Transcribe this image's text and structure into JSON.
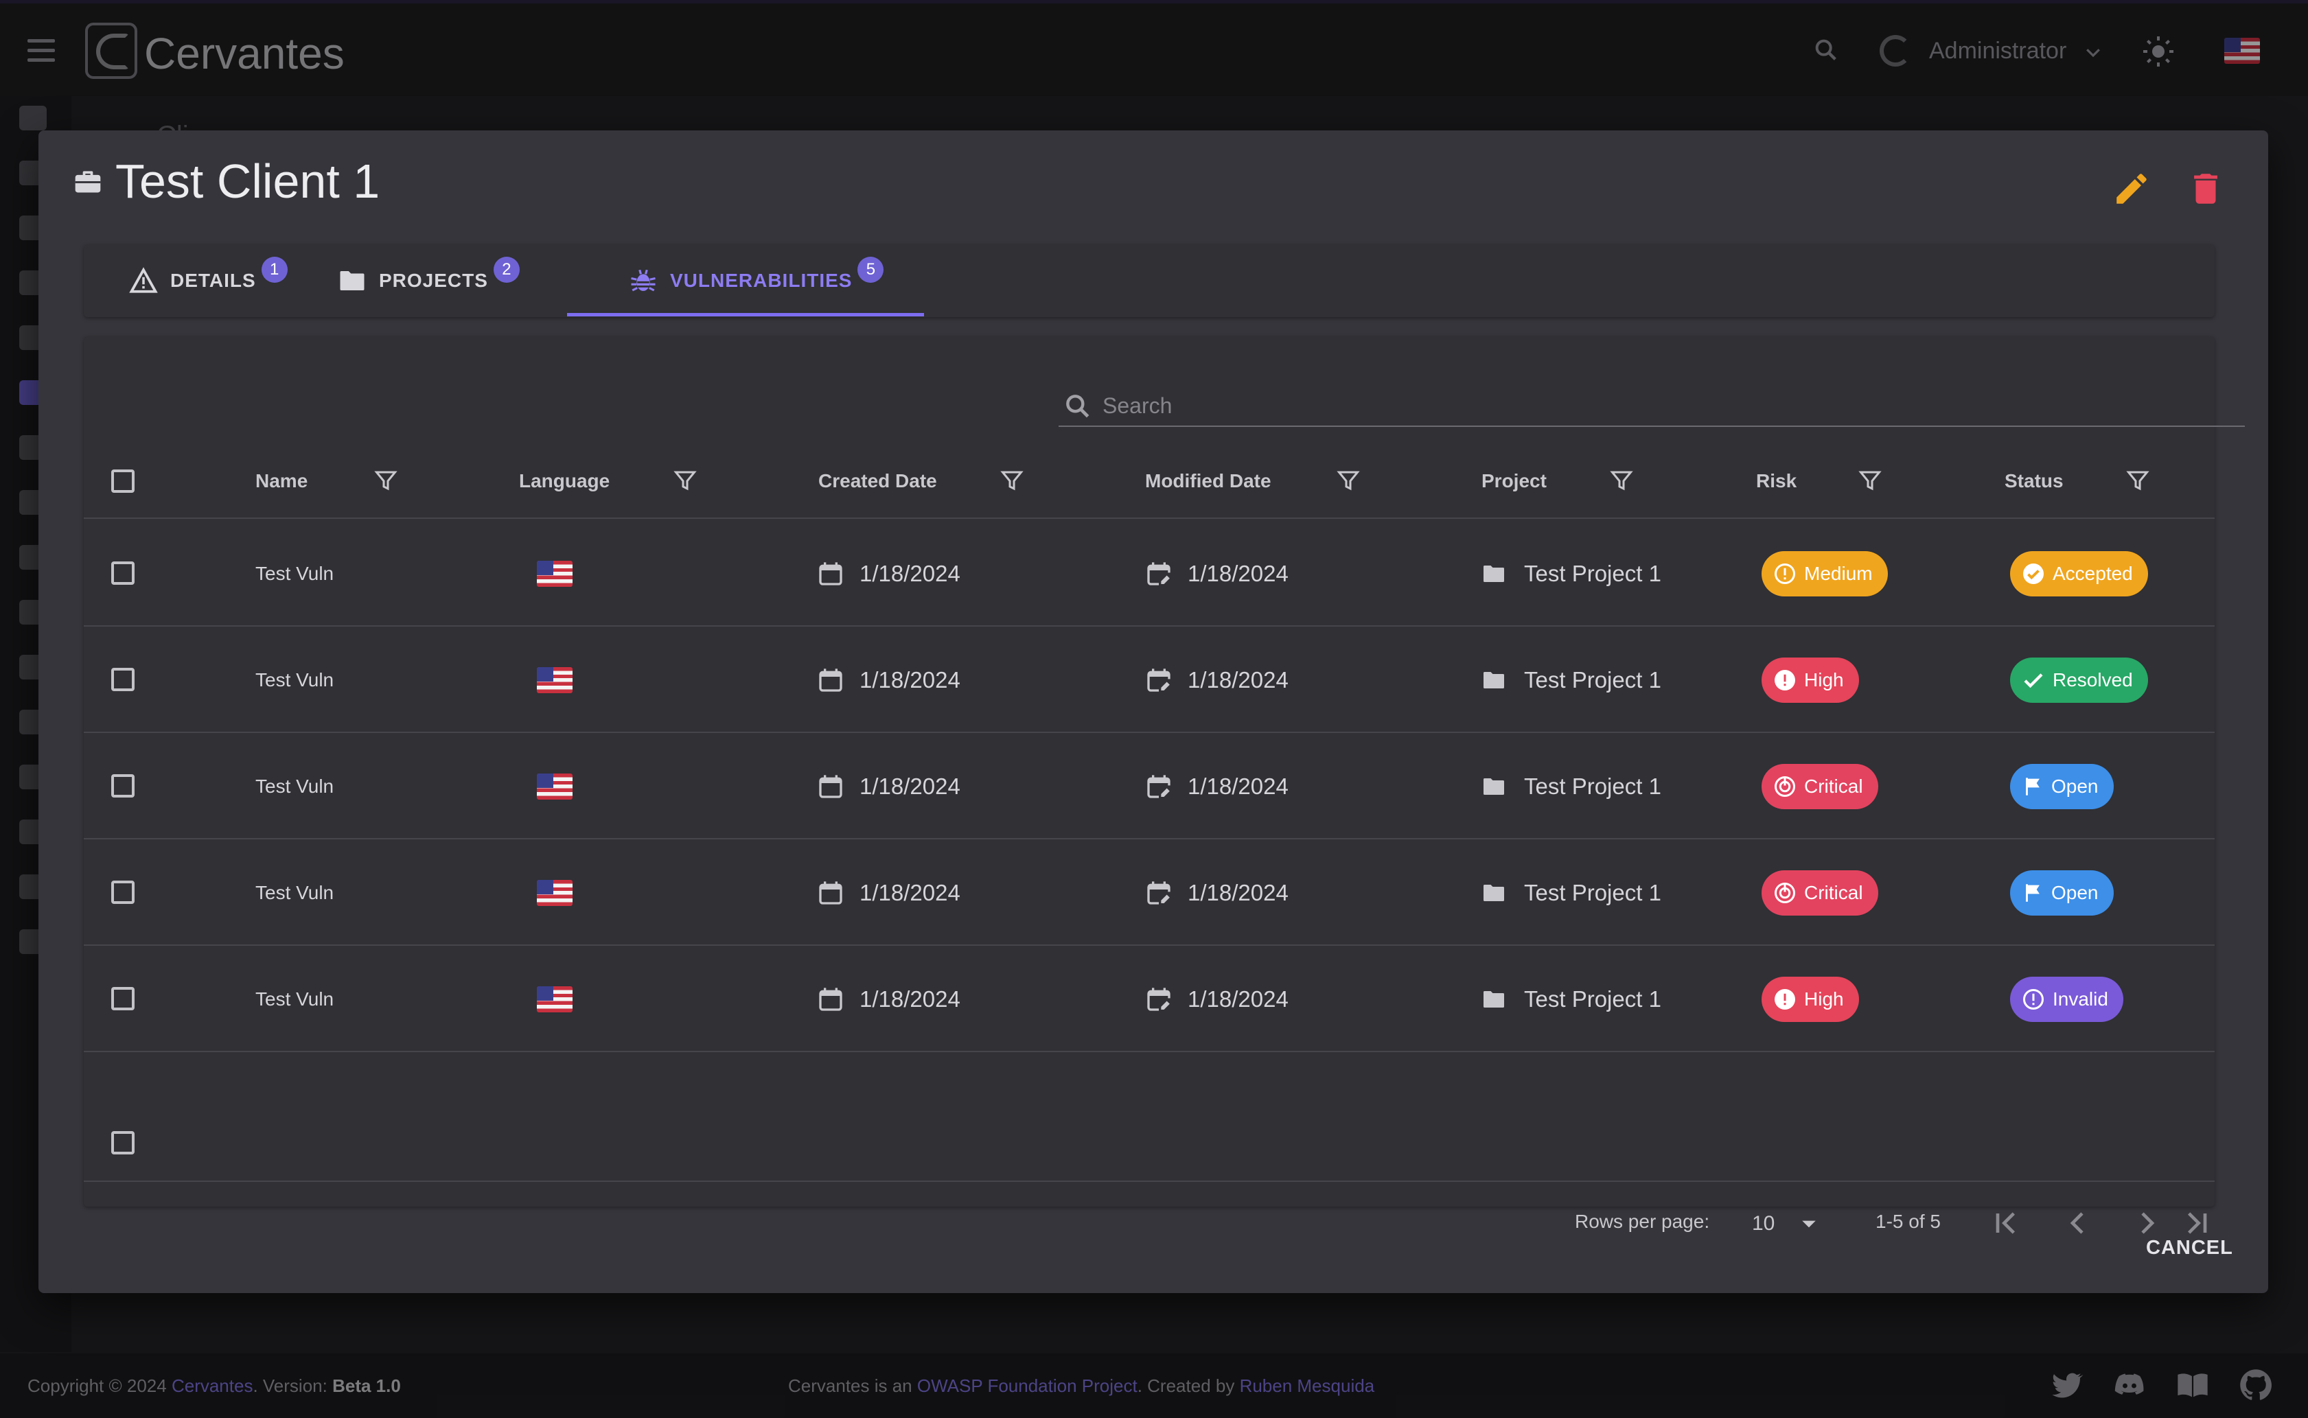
{
  "app": {
    "title": "Cervantes",
    "user": "Administrator"
  },
  "background": {
    "breadcrumb": "Cli"
  },
  "dialog": {
    "title": "Test Client 1",
    "tabs": [
      {
        "label": "DETAILS",
        "count": "1",
        "icon": "warning-icon",
        "active": false
      },
      {
        "label": "PROJECTS",
        "count": "2",
        "icon": "folder-icon",
        "active": false
      },
      {
        "label": "VULNERABILITIES",
        "count": "5",
        "icon": "bug-icon",
        "active": true
      }
    ],
    "search": {
      "placeholder": "Search",
      "value": ""
    },
    "columns": [
      "Name",
      "Language",
      "Created Date",
      "Modified Date",
      "Project",
      "Risk",
      "Status"
    ],
    "rows": [
      {
        "name": "Test Vuln",
        "language": "en-US flag",
        "created": "1/18/2024",
        "modified": "1/18/2024",
        "project": "Test Project 1",
        "risk": "Medium",
        "status": "Accepted"
      },
      {
        "name": "Test Vuln",
        "language": "en-US flag",
        "created": "1/18/2024",
        "modified": "1/18/2024",
        "project": "Test Project 1",
        "risk": "High",
        "status": "Resolved"
      },
      {
        "name": "Test Vuln",
        "language": "en-US flag",
        "created": "1/18/2024",
        "modified": "1/18/2024",
        "project": "Test Project 1",
        "risk": "Critical",
        "status": "Open"
      },
      {
        "name": "Test Vuln",
        "language": "en-US flag",
        "created": "1/18/2024",
        "modified": "1/18/2024",
        "project": "Test Project 1",
        "risk": "Critical",
        "status": "Open"
      },
      {
        "name": "Test Vuln",
        "language": "en-US flag",
        "created": "1/18/2024",
        "modified": "1/18/2024",
        "project": "Test Project 1",
        "risk": "High",
        "status": "Invalid"
      }
    ],
    "pagination": {
      "rows_per_page_label": "Rows per page:",
      "rows_per_page": "10",
      "range": "1-5 of 5"
    },
    "cancel_label": "CANCEL"
  },
  "footer": {
    "copyright_prefix": "Copyright © 2024 ",
    "copyright_link": "Cervantes",
    "version_prefix": ". Version: ",
    "version": "Beta 1.0",
    "center_prefix": "Cervantes is an ",
    "owasp_link": "OWASP Foundation Project",
    "created_by": ". Created by ",
    "author_link": "Ruben Mesquida"
  },
  "colors": {
    "accent": "#7d6df0",
    "medium": "#f0a51e",
    "high": "#e5445a",
    "critical": "#e3435f",
    "accepted": "#f0a51e",
    "resolved": "#27a866",
    "open": "#3d8fe8",
    "invalid": "#7a5ad8",
    "edit": "#f0a51e",
    "delete": "#e5445a"
  }
}
